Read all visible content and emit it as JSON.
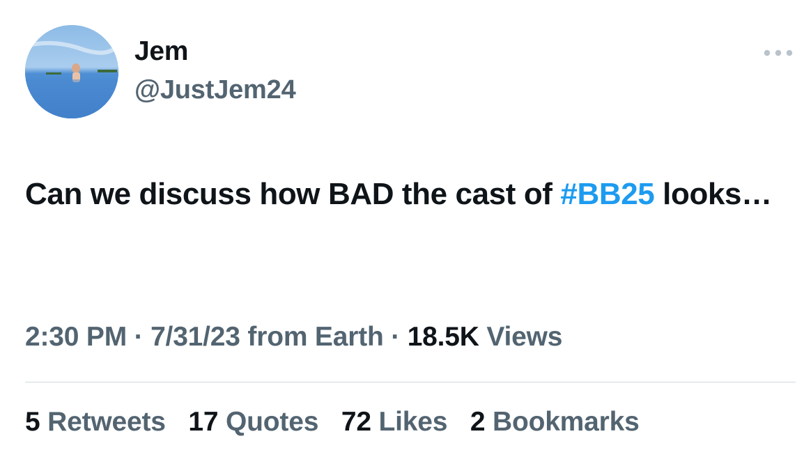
{
  "author": {
    "display_name": "Jem",
    "handle": "@JustJem24",
    "avatar_icon": "profile-photo-pool"
  },
  "more_icon": "more-horizontal-icon",
  "tweet": {
    "text_before": "Can we discuss how BAD the cast of ",
    "hashtag": "#BB25",
    "text_after": " looks…"
  },
  "meta": {
    "time": "2:30 PM",
    "sep1": " · ",
    "date": "7/31/23",
    "source": " from Earth",
    "sep2": " · ",
    "views_count": "18.5K",
    "views_label": " Views"
  },
  "stats": [
    {
      "count": "5",
      "label": " Retweets"
    },
    {
      "count": "17",
      "label": " Quotes"
    },
    {
      "count": "72",
      "label": " Likes"
    },
    {
      "count": "2",
      "label": " Bookmarks"
    }
  ],
  "colors": {
    "text": "#0f1419",
    "secondary": "#536471",
    "link": "#1d9bf0",
    "divider": "#cfd9de"
  }
}
